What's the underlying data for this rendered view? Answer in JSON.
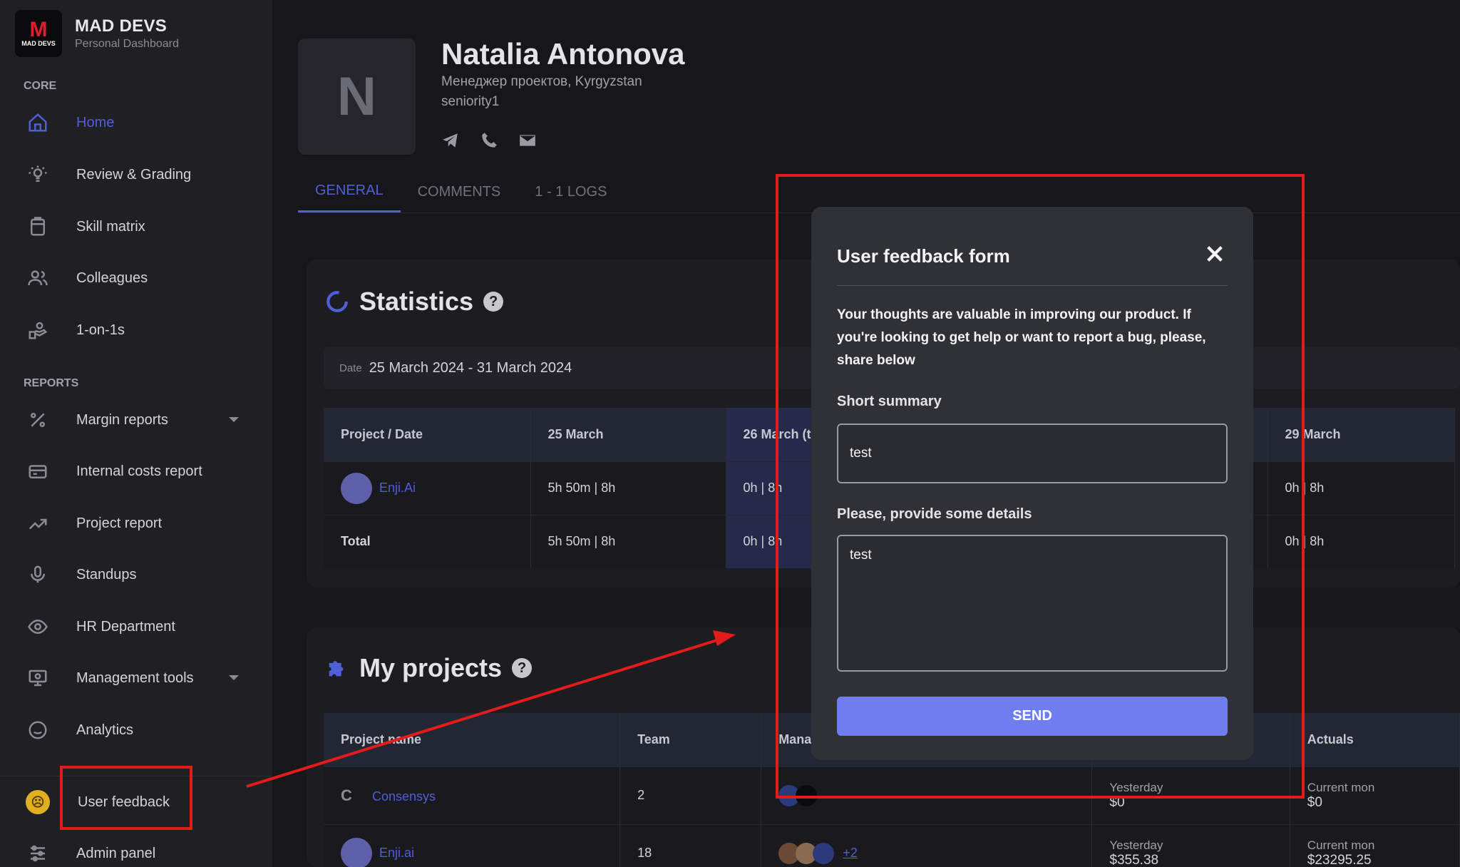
{
  "brand": {
    "logo_letter": "M",
    "logo_sub": "MAD DEVS",
    "name": "MAD DEVS",
    "subtitle": "Personal Dashboard"
  },
  "sidebar": {
    "core_label": "CORE",
    "reports_label": "REPORTS",
    "items": [
      {
        "label": "Home",
        "icon": "home-icon",
        "active": true
      },
      {
        "label": "Review & Grading",
        "icon": "bulb-icon"
      },
      {
        "label": "Skill matrix",
        "icon": "clipboard-icon"
      },
      {
        "label": "Colleagues",
        "icon": "people-icon"
      },
      {
        "label": "1-on-1s",
        "icon": "handshake-icon"
      },
      {
        "label": "Margin reports",
        "icon": "percent-icon",
        "expandable": true
      },
      {
        "label": "Internal costs report",
        "icon": "card-icon"
      },
      {
        "label": "Project report",
        "icon": "trend-icon"
      },
      {
        "label": "Standups",
        "icon": "mic-icon"
      },
      {
        "label": "HR Department",
        "icon": "eye-icon"
      },
      {
        "label": "Management tools",
        "icon": "monitor-icon",
        "expandable": true
      },
      {
        "label": "Analytics",
        "icon": "smile-icon"
      },
      {
        "label": "User feedback",
        "icon": "angry-face-icon"
      },
      {
        "label": "Admin panel",
        "icon": "sliders-icon"
      }
    ]
  },
  "profile": {
    "initial": "N",
    "name": "Natalia Antonova",
    "role": "Менеджер проектов, Kyrgyzstan",
    "seniority": "seniority1"
  },
  "tabs": [
    "GENERAL",
    "COMMENTS",
    "1 - 1 LOGS"
  ],
  "statistics": {
    "title": "Statistics",
    "help": "?",
    "date_label": "Date",
    "date_range": "25 March 2024 - 31 March 2024",
    "headers": [
      "Project / Date",
      "25 March",
      "26 March (t",
      "29 March"
    ],
    "rows": [
      {
        "project": "Enji.Ai",
        "c1": "5h 50m | 8h",
        "c2": "0h | 8h",
        "c3": "0h | 8h"
      },
      {
        "project": "Total",
        "c1": "5h 50m | 8h",
        "c2": "0h | 8h",
        "c3": "0h | 8h"
      }
    ]
  },
  "projects": {
    "title": "My projects",
    "help": "?",
    "headers": [
      "Project name",
      "Team",
      "Mana",
      "",
      "Actuals"
    ],
    "rows": [
      {
        "letter": "C",
        "name": "Consensys",
        "team": "2",
        "managers_more": "",
        "plan_label": "Yesterday",
        "plan_value": "$0",
        "act_label": "Current mon",
        "act_value": "$0"
      },
      {
        "letter": "",
        "name": "Enji.ai",
        "team": "18",
        "managers_more": "+2",
        "plan_label": "Yesterday",
        "plan_value": "$355.38",
        "act_label": "Current mon",
        "act_value": "$23295.25"
      }
    ]
  },
  "modal": {
    "title": "User feedback form",
    "description": "Your thoughts are valuable in improving our product. If you're looking to get help or want to report a bug, please, share below",
    "summary_label": "Short summary",
    "summary_value": "test",
    "details_label": "Please, provide some details",
    "details_value": "test",
    "send_label": "SEND"
  },
  "colors": {
    "accent": "#4f5fd6",
    "send": "#6e7ef0",
    "annotation": "#e31b1b",
    "background": "#17171b"
  }
}
